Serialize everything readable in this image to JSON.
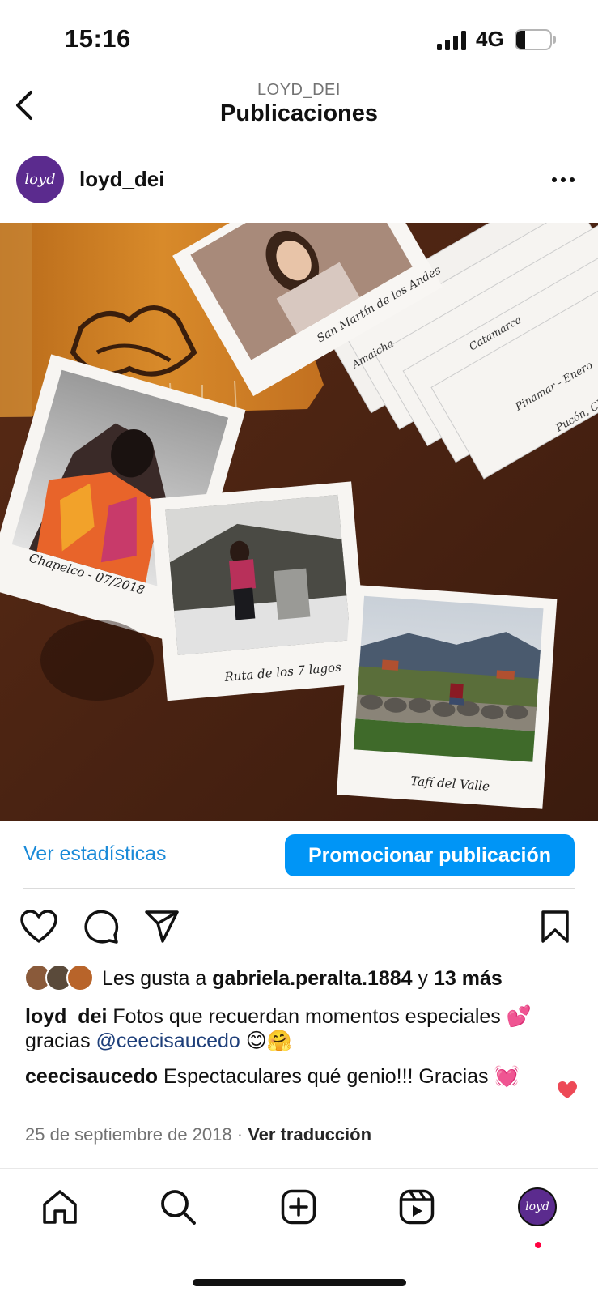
{
  "status_bar": {
    "time": "15:16",
    "network": "4G",
    "battery_level": "27",
    "battery_fraction": 0.27
  },
  "header": {
    "subtitle": "LOYD_DEI",
    "title": "Publicaciones"
  },
  "post": {
    "username": "loyd_dei",
    "avatar_text": "loyd",
    "image_captions": {
      "polaroid_1": "Chapelco - 07/2018",
      "polaroid_2": "Ruta de los 7 lagos",
      "polaroid_3": "Tafí del Valle",
      "card_1": "San Martín de los Andes",
      "card_2": "Amaicha",
      "card_3": "Catamarca",
      "card_4": "Pinamar - Enero",
      "card_5": "Pucón, Ch"
    },
    "stats_link": "Ver estadísticas",
    "promote_button": "Promocionar publicación",
    "likes": {
      "prefix": "Les gusta a ",
      "user": "gabriela.peralta.1884",
      "connector": " y ",
      "others": "13 más"
    },
    "caption": {
      "username": "loyd_dei",
      "text": " Fotos que recuerdan momentos especiales 💕 gracias ",
      "mention": "@ceecisaucedo",
      "emojis": " 😊🤗"
    },
    "comment": {
      "username": "ceecisaucedo",
      "text": " Espectaculares qué genio!!! Gracias 💓"
    },
    "date": "25 de septiembre de 2018",
    "separator": " · ",
    "translate_link": "Ver traducción"
  },
  "colors": {
    "accent": "#0095f6",
    "link": "#1a8ad8",
    "brand_purple": "#5b2b8e",
    "heart": "#ed4956"
  },
  "icons": {
    "back": "chevron-left-icon",
    "more": "more-horizontal-icon",
    "like": "heart-outline-icon",
    "comment": "comment-bubble-icon",
    "share": "paper-plane-icon",
    "save": "bookmark-icon",
    "home": "home-icon",
    "search": "search-icon",
    "create": "plus-square-icon",
    "reels": "reels-icon"
  }
}
